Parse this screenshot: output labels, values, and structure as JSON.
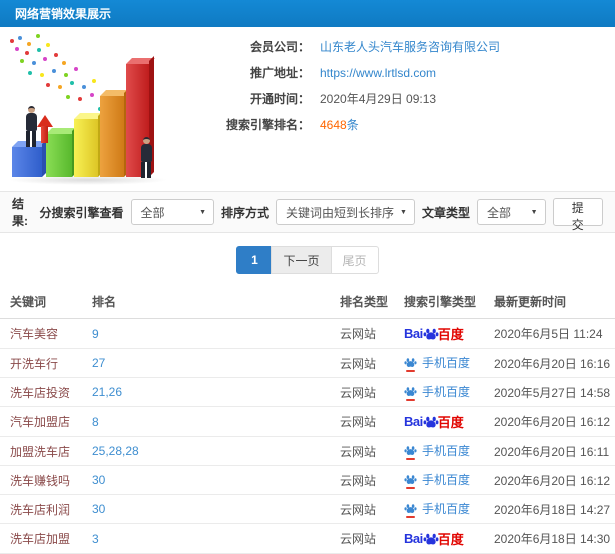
{
  "header": {
    "title": "网络营销效果展示"
  },
  "member": {
    "company_label": "会员公司：",
    "company": "山东老人头汽车服务咨询有限公司",
    "url_label": "推广地址：",
    "url": "https://www.lrtlsd.com",
    "opened_label": "开通时间：",
    "opened": "2020年4月29日 09:13",
    "rank_label": "搜索引擎排名：",
    "rank_count": "4648",
    "rank_unit": "条"
  },
  "filters": {
    "section_label": "结果:",
    "engine_filter_label": "分搜索引擎查看",
    "engine_filter_value": "全部",
    "sort_label": "排序方式",
    "sort_value": "关键词由短到长排序",
    "article_type_label": "文章类型",
    "article_type_value": "全部",
    "submit_label": "提交"
  },
  "pagination": {
    "current": "1",
    "next": "下一页",
    "last": "尾页"
  },
  "table": {
    "columns": [
      "关键词",
      "排名",
      "排名类型",
      "搜索引擎类型",
      "最新更新时间"
    ],
    "rows": [
      {
        "keyword": "汽车美容",
        "rank": "9",
        "rank_type": "云网站",
        "engine": "baidu",
        "updated": "2020年6月5日 11:24"
      },
      {
        "keyword": "开洗车行",
        "rank": "27",
        "rank_type": "云网站",
        "engine": "mobile_baidu",
        "updated": "2020年6月20日 16:16"
      },
      {
        "keyword": "洗车店投资",
        "rank": "21,26",
        "rank_type": "云网站",
        "engine": "mobile_baidu",
        "updated": "2020年5月27日 14:58"
      },
      {
        "keyword": "汽车加盟店",
        "rank": "8",
        "rank_type": "云网站",
        "engine": "baidu",
        "updated": "2020年6月20日 16:12"
      },
      {
        "keyword": "加盟洗车店",
        "rank": "25,28,28",
        "rank_type": "云网站",
        "engine": "mobile_baidu",
        "updated": "2020年6月20日 16:11"
      },
      {
        "keyword": "洗车赚钱吗",
        "rank": "30",
        "rank_type": "云网站",
        "engine": "mobile_baidu",
        "updated": "2020年6月20日 16:12"
      },
      {
        "keyword": "洗车店利润",
        "rank": "30",
        "rank_type": "云网站",
        "engine": "mobile_baidu",
        "updated": "2020年6月18日 14:27"
      },
      {
        "keyword": "洗车店加盟",
        "rank": "3",
        "rank_type": "云网站",
        "engine": "baidu",
        "updated": "2020年6月18日 14:30"
      }
    ]
  },
  "engines": {
    "baidu": {
      "text_latin": "Bai",
      "text_cn": "百度",
      "icon": "baidu-paw-icon",
      "color_blue": "#2534dd",
      "color_red": "#e10602"
    },
    "mobile_baidu": {
      "label": "手机百度",
      "icon": "baidu-paw-icon",
      "color": "#3a87d2"
    }
  },
  "colors": {
    "header_bg": "#1182ca",
    "link_blue": "#3386cc",
    "highlight_orange": "#ff6600",
    "pagination_active": "#2f7ec7",
    "keyword_link": "#8a4a4a"
  }
}
